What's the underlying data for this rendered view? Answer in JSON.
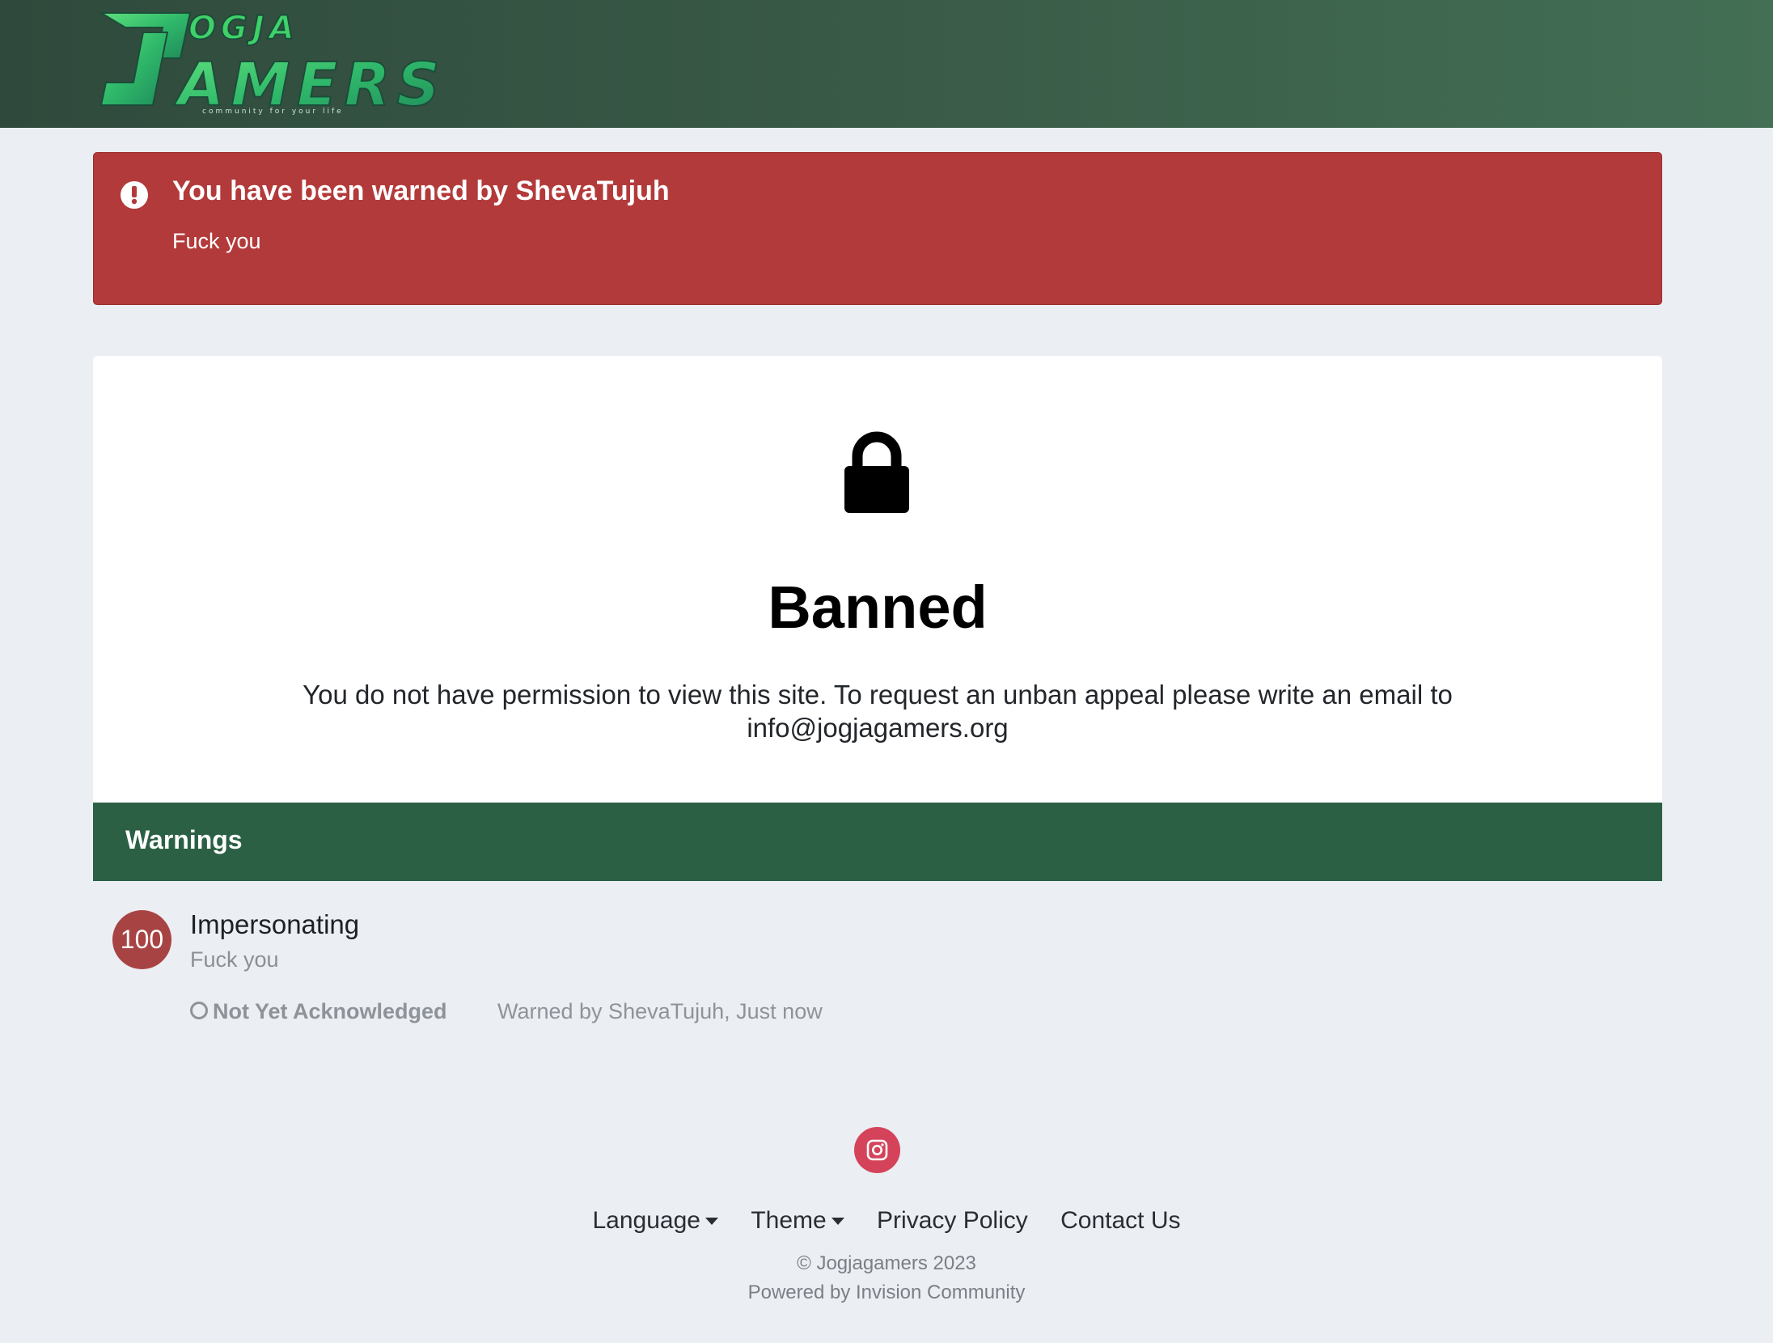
{
  "header": {
    "logo_text": "JOGJA GAMERS",
    "logo_tagline": "community for your life",
    "colors": {
      "bg_start": "#2f4a3c",
      "bg_end": "#436f55",
      "logo_green": "#3fd16a"
    }
  },
  "warning_banner": {
    "icon": "exclamation-circle-icon",
    "title": "You have been warned by ShevaTujuh",
    "message": "Fuck you",
    "color": "#b33a3a"
  },
  "ban": {
    "icon": "lock-icon",
    "title": "Banned",
    "message": "You do not have permission to view this site. To request an unban appeal please write an email to info@jogjagamers.org"
  },
  "warnings": {
    "heading": "Warnings",
    "header_color": "#2b6045",
    "items": [
      {
        "points": "100",
        "reason": "Impersonating",
        "note": "Fuck you",
        "status": "Not Yet Acknowledged",
        "status_icon": "circle-outline-icon",
        "meta": "Warned by ShevaTujuh, Just now"
      }
    ]
  },
  "footer": {
    "social_icon": "instagram-icon",
    "links": {
      "language": "Language",
      "theme": "Theme",
      "privacy": "Privacy Policy",
      "contact": "Contact Us"
    },
    "copyright": "© Jogjagamers 2023",
    "powered_by": "Powered by Invision Community"
  }
}
